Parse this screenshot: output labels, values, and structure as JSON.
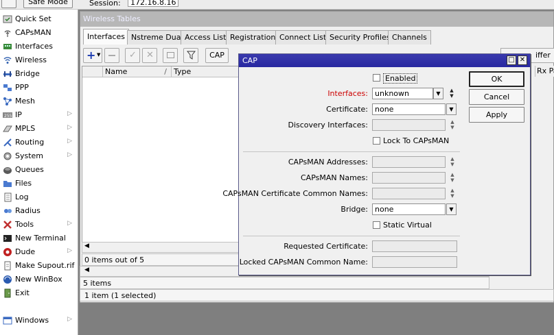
{
  "topbar": {
    "safe_mode": "Safe Mode",
    "session_label": "Session:",
    "session_value": "172.16.8.16"
  },
  "sidebar": {
    "items": [
      {
        "label": "Quick Set",
        "icon": "quick-set-icon",
        "submenu": false
      },
      {
        "label": "CAPsMAN",
        "icon": "capsman-icon",
        "submenu": false
      },
      {
        "label": "Interfaces",
        "icon": "interfaces-icon",
        "submenu": false
      },
      {
        "label": "Wireless",
        "icon": "wireless-icon",
        "submenu": false
      },
      {
        "label": "Bridge",
        "icon": "bridge-icon",
        "submenu": false
      },
      {
        "label": "PPP",
        "icon": "ppp-icon",
        "submenu": false
      },
      {
        "label": "Mesh",
        "icon": "mesh-icon",
        "submenu": false
      },
      {
        "label": "IP",
        "icon": "ip-icon",
        "submenu": true
      },
      {
        "label": "MPLS",
        "icon": "mpls-icon",
        "submenu": true
      },
      {
        "label": "Routing",
        "icon": "routing-icon",
        "submenu": true
      },
      {
        "label": "System",
        "icon": "system-icon",
        "submenu": true
      },
      {
        "label": "Queues",
        "icon": "queues-icon",
        "submenu": false
      },
      {
        "label": "Files",
        "icon": "files-icon",
        "submenu": false
      },
      {
        "label": "Log",
        "icon": "log-icon",
        "submenu": false
      },
      {
        "label": "Radius",
        "icon": "radius-icon",
        "submenu": false
      },
      {
        "label": "Tools",
        "icon": "tools-icon",
        "submenu": true
      },
      {
        "label": "New Terminal",
        "icon": "terminal-icon",
        "submenu": false
      },
      {
        "label": "Dude",
        "icon": "dude-icon",
        "submenu": true
      },
      {
        "label": "Make Supout.rif",
        "icon": "supout-icon",
        "submenu": false
      },
      {
        "label": "New WinBox",
        "icon": "winbox-icon",
        "submenu": false
      },
      {
        "label": "Exit",
        "icon": "exit-icon",
        "submenu": false
      },
      {
        "label": "Windows",
        "icon": "windows-icon",
        "submenu": true
      }
    ]
  },
  "wireless_tables": {
    "title": "Wireless Tables",
    "tabs": [
      "Interfaces",
      "Nstreme Dual",
      "Access List",
      "Registration",
      "Connect List",
      "Security Profiles",
      "Channels"
    ],
    "active_tab": "Interfaces",
    "toolbar": {
      "cap_label": "CAP",
      "sniffer_partial": "iffer"
    },
    "columns": [
      "Name",
      "Type"
    ],
    "col_partial": "Rx Pa",
    "status": "0 items out of 5"
  },
  "lower": {
    "items": "5 items",
    "selected": "1 item (1 selected)"
  },
  "cap_dialog": {
    "title": "CAP",
    "enabled_label": "Enabled",
    "interfaces_label": "Interfaces:",
    "interfaces_value": "unknown",
    "certificate_label": "Certificate:",
    "certificate_value": "none",
    "discovery_label": "Discovery Interfaces:",
    "lock_label": "Lock To CAPsMAN",
    "capsman_addresses_label": "CAPsMAN Addresses:",
    "capsman_names_label": "CAPsMAN Names:",
    "capsman_cert_names_label": "CAPsMAN Certificate Common Names:",
    "bridge_label": "Bridge:",
    "bridge_value": "none",
    "static_virtual_label": "Static Virtual",
    "requested_cert_label": "Requested Certificate:",
    "locked_names_label": "Locked CAPsMAN Common Name:",
    "ok": "OK",
    "cancel": "Cancel",
    "apply": "Apply"
  },
  "colors": {
    "title_active": "#2a2aa4",
    "required_label": "#cc0000",
    "sidebar_bg": "#ffffff"
  }
}
